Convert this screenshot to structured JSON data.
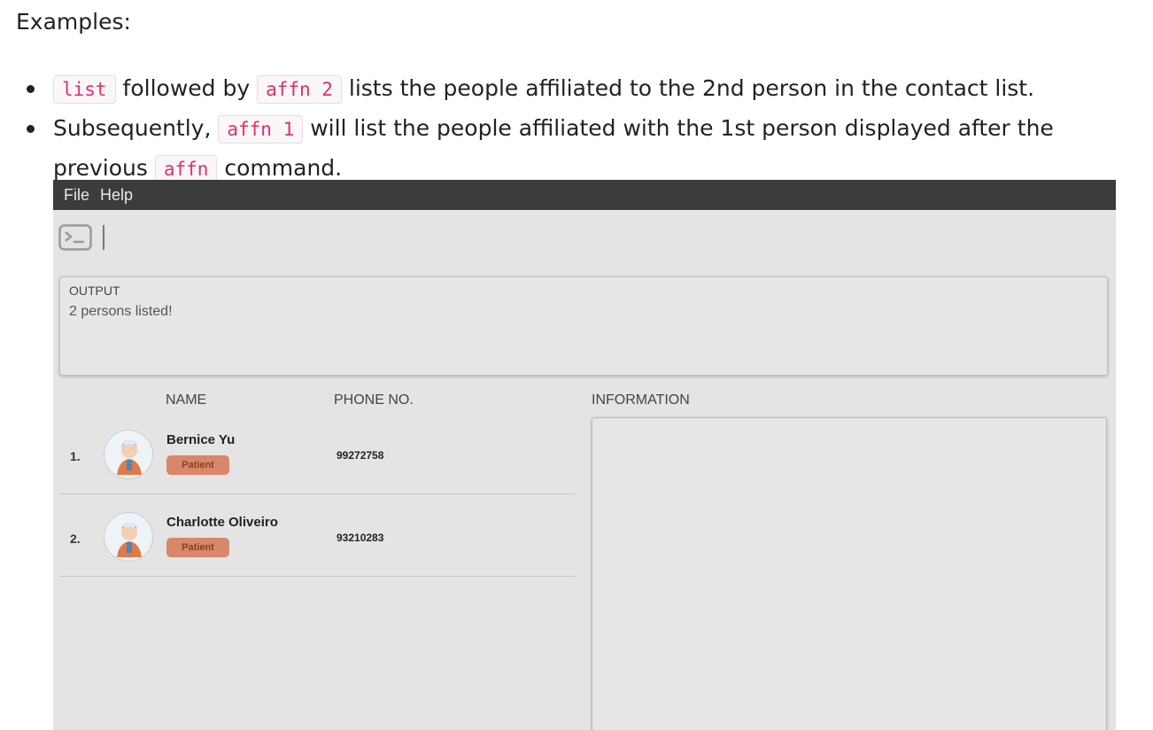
{
  "doc": {
    "heading": "Examples:",
    "items": [
      {
        "code1": "list",
        "text1": "followed by",
        "code2": "affn 2",
        "text2": "lists the people affiliated to the 2nd person in the contact list."
      },
      {
        "text1": "Subsequently,",
        "code1": "affn 1",
        "text2": "will list the people affiliated with the 1st person displayed after the previous",
        "code2": "affn",
        "text3": "command."
      }
    ]
  },
  "app": {
    "menu": [
      "File",
      "Help"
    ],
    "command_icon": "terminal-icon",
    "output": {
      "title": "OUTPUT",
      "text": "2 persons listed!"
    },
    "columns": {
      "name": "NAME",
      "phone": "PHONE NO.",
      "info": "INFORMATION"
    },
    "persons": [
      {
        "index": "1.",
        "name": "Bernice Yu",
        "tag": "Patient",
        "phone": "99272758",
        "avatar": "nurse-avatar-icon"
      },
      {
        "index": "2.",
        "name": "Charlotte Oliveiro",
        "tag": "Patient",
        "phone": "93210283",
        "avatar": "nurse-avatar-icon"
      }
    ],
    "colors": {
      "menubar": "#3c3c3c",
      "background": "#e4e4e4",
      "tag_bg": "#d9876a",
      "code_text": "#d6336c"
    }
  }
}
